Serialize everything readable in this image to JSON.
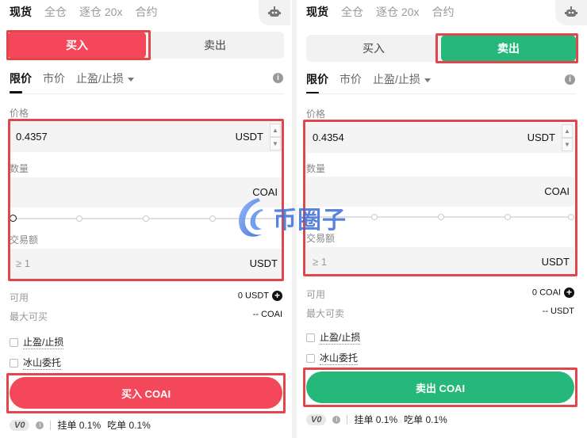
{
  "top_tabs": [
    "现货",
    "全仓",
    "逐仓 20x",
    "合约"
  ],
  "buy_sell": {
    "buy": "买入",
    "sell": "卖出"
  },
  "order_types": {
    "limit": "限价",
    "market": "市价",
    "tpsl": "止盈/止损"
  },
  "labels": {
    "price": "价格",
    "quantity": "数量",
    "amount": "交易额",
    "available": "可用",
    "max_buy": "最大可买",
    "max_sell": "最大可卖",
    "tpsl_checkbox": "止盈/止损",
    "iceberg_checkbox": "冰山委托"
  },
  "left": {
    "price_value": "0.4357",
    "price_unit": "USDT",
    "quantity_unit": "COAI",
    "amount_placeholder": "≥ 1",
    "amount_unit": "USDT",
    "available_value": "0 USDT",
    "max_value": "-- COAI",
    "action_label": "买入 COAI"
  },
  "right": {
    "price_value": "0.4354",
    "price_unit": "USDT",
    "quantity_unit": "COAI",
    "amount_placeholder": "≥ 1",
    "amount_unit": "USDT",
    "available_value": "0 COAI",
    "max_value": "-- USDT",
    "action_label": "卖出 COAI"
  },
  "fees": {
    "vip": "V0",
    "maker": "挂单 0.1%",
    "taker": "吃单 0.1%"
  },
  "watermark": "币圈子",
  "colors": {
    "buy": "#f4485a",
    "sell": "#26b77b",
    "highlight": "#e0474c"
  }
}
